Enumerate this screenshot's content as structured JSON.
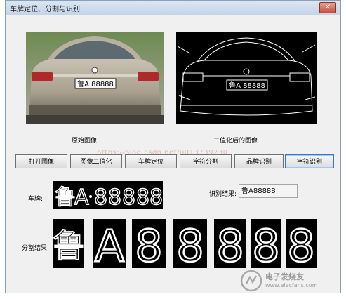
{
  "window": {
    "title": "车牌定位、分割与识别",
    "close_glyph": "✕"
  },
  "images": {
    "original_caption": "原始图像",
    "binary_caption": "二值化后的图像",
    "plate_text_on_car": "鲁A 88888"
  },
  "buttons": [
    {
      "label": "打开图像"
    },
    {
      "label": "图像二值化"
    },
    {
      "label": "车牌定位"
    },
    {
      "label": "字符分割"
    },
    {
      "label": "品牌识别"
    },
    {
      "label": "字符识别"
    }
  ],
  "plate": {
    "label": "车牌:"
  },
  "result": {
    "label": "识别结果:",
    "value": "鲁A88888"
  },
  "segmentation": {
    "label": "分割结果:",
    "chars": [
      "鲁",
      "A",
      "8",
      "8",
      "8",
      "8",
      "8"
    ]
  },
  "watermark": "https://blog.csdn.net/u013739230",
  "brand": {
    "name": "电子发烧友",
    "url": "www.elecfans.com"
  }
}
